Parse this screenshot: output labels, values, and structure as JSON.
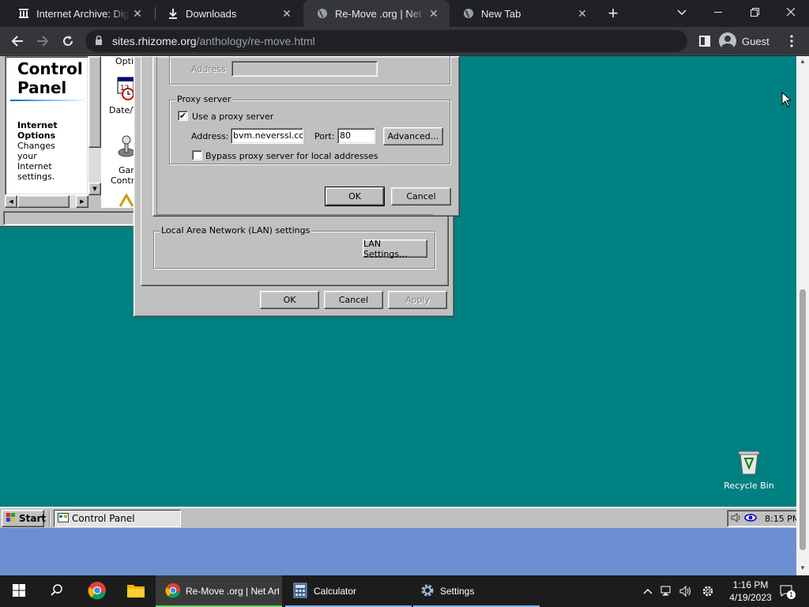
{
  "browser": {
    "tabs": [
      {
        "title": "Internet Archive: Digital Library of Free & Borrowable Books, Movies, Music & Wayback Machine",
        "icon": "archive-icon",
        "active": false
      },
      {
        "title": "Downloads",
        "icon": "download-icon",
        "active": false
      },
      {
        "title": "Re-Move .org | Net Art Anthology",
        "icon": "globe-icon",
        "active": true
      },
      {
        "title": "New Tab",
        "icon": "globe-icon",
        "active": false
      }
    ],
    "url_host": "sites.rhizome.org",
    "url_path": "/anthology/re-move.html",
    "profile_label": "Guest"
  },
  "control_panel": {
    "title_line1": "Control",
    "title_line2": "Panel",
    "desc_title_line1": "Internet",
    "desc_title_line2": "Options",
    "desc_lines": [
      "Changes",
      "your",
      "Internet",
      "settings."
    ],
    "icon_labels": [
      "Optic",
      "Date/T",
      "Gan",
      "Contro"
    ]
  },
  "proxy_dialog": {
    "address_label": "Address",
    "proxy_group_label": "Proxy server",
    "use_proxy_label": "Use a proxy server",
    "use_proxy_checked": "✔",
    "proxy_address_label": "Address:",
    "proxy_address_value": "bvm.neverssl.com",
    "port_label": "Port:",
    "port_value": "80",
    "advanced_label": "Advanced...",
    "bypass_label": "Bypass proxy server for local addresses",
    "ok_label": "OK",
    "cancel_label": "Cancel"
  },
  "props_dialog": {
    "lan_group_label": "Local Area Network (LAN) settings",
    "lan_settings_label": "LAN Settings...",
    "ok_label": "OK",
    "cancel_label": "Cancel",
    "apply_label": "Apply"
  },
  "desktop": {
    "recycle_bin_label": "Recycle Bin"
  },
  "w98_taskbar": {
    "start_label": "Start",
    "task_label": "Control Panel",
    "time": "8:15 PM"
  },
  "win_taskbar": {
    "items": [
      {
        "label": "Re-Move .org | Net Art Anthology",
        "icon": "chrome-icon"
      },
      {
        "label": "Calculator",
        "icon": "calculator-icon"
      },
      {
        "label": "Settings",
        "icon": "gear-icon"
      }
    ],
    "time": "1:16 PM",
    "date": "4/19/2023",
    "notification_count": "1"
  },
  "colors": {
    "desktop_teal": "#008080",
    "chrome_dark": "#202124",
    "page_bg": "#6c8fd4"
  }
}
